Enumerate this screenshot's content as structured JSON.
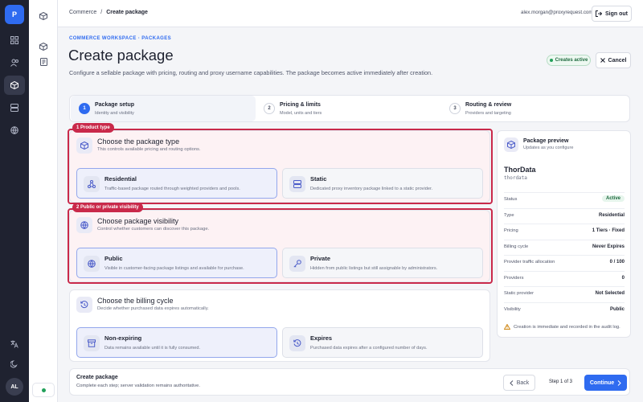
{
  "rail": {
    "logo_letter": "P",
    "avatar_initials": "AL"
  },
  "topbar": {
    "breadcrumb": [
      "Commerce",
      "Create package"
    ],
    "separator": "/",
    "email": "alex.morgan@proxyrequest.com",
    "sign_out_label": "Sign out"
  },
  "header": {
    "eyebrow": "COMMERCE WORKSPACE · PACKAGES",
    "title": "Create package",
    "description": "Configure a sellable package with pricing, routing and proxy username capabilities. The package becomes active immediately after creation.",
    "status_badge": "Creates active",
    "cancel_label": "Cancel"
  },
  "steps": [
    {
      "num": "1",
      "title": "Package setup",
      "sub": "Identity and visibility"
    },
    {
      "num": "2",
      "title": "Pricing & limits",
      "sub": "Model, units and tiers"
    },
    {
      "num": "3",
      "title": "Routing & review",
      "sub": "Providers and targeting"
    }
  ],
  "highlight_tags": [
    "1 Product type",
    "2 Public or private visibility"
  ],
  "sections": {
    "type": {
      "title": "Choose the package type",
      "sub": "This controls available pricing and routing options.",
      "options": [
        {
          "title": "Residential",
          "sub": "Traffic-based package routed through weighted providers and pools."
        },
        {
          "title": "Static",
          "sub": "Dedicated proxy inventory package linked to a static provider."
        }
      ]
    },
    "visibility": {
      "title": "Choose package visibility",
      "sub": "Control whether customers can discover this package.",
      "options": [
        {
          "title": "Public",
          "sub": "Visible in customer-facing package listings and available for purchase."
        },
        {
          "title": "Private",
          "sub": "Hidden from public listings but still assignable by administrators."
        }
      ]
    },
    "billing": {
      "title": "Choose the billing cycle",
      "sub": "Decide whether purchased data expires automatically.",
      "options": [
        {
          "title": "Non-expiring",
          "sub": "Data remains available until it is fully consumed."
        },
        {
          "title": "Expires",
          "sub": "Purchased data expires after a configured number of days."
        }
      ]
    }
  },
  "preview": {
    "title": "Package preview",
    "sub": "Updates as you configure",
    "name": "ThorData",
    "code": "thordata",
    "rows": [
      {
        "k": "Status",
        "v": "Active"
      },
      {
        "k": "Type",
        "v": "Residential"
      },
      {
        "k": "Pricing",
        "v": "1 Tiers · Fixed"
      },
      {
        "k": "Billing cycle",
        "v": "Never Expires"
      },
      {
        "k": "Provider traffic allocation",
        "v": "0 / 100"
      },
      {
        "k": "Providers",
        "v": "0"
      },
      {
        "k": "Static provider",
        "v": "Not Selected"
      },
      {
        "k": "Visibility",
        "v": "Public"
      }
    ],
    "note": "Creation is immediate and recorded in the audit log."
  },
  "footer": {
    "title": "Create package",
    "sub": "Complete each step; server validation remains authoritative.",
    "back_label": "Back",
    "step_indicator": "Step 1 of 3",
    "continue_label": "Continue"
  },
  "colors": {
    "accent": "#2f6bf0",
    "highlight": "#c9294a",
    "success": "#22a05a"
  }
}
